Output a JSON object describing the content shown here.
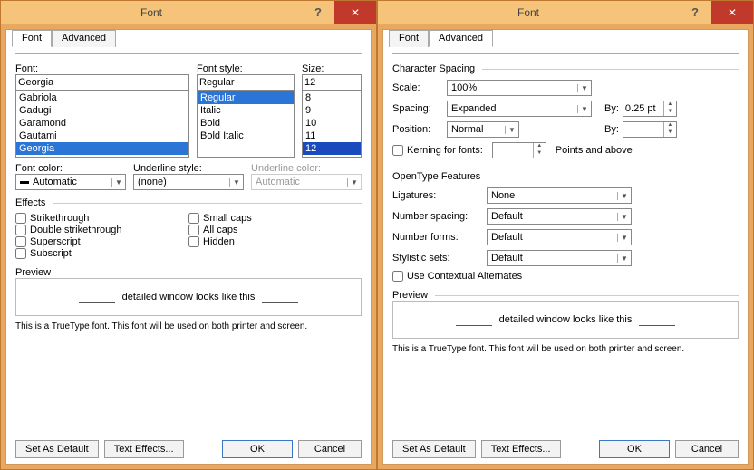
{
  "titlebar": {
    "title": "Font"
  },
  "tabs": {
    "font": "Font",
    "advanced": "Advanced"
  },
  "left": {
    "font_label": "Font:",
    "font_value": "Georgia",
    "font_list": [
      "Gabriola",
      "Gadugi",
      "Garamond",
      "Gautami",
      "Georgia"
    ],
    "style_label": "Font style:",
    "style_value": "Regular",
    "style_list": [
      "Regular",
      "Italic",
      "Bold",
      "Bold Italic"
    ],
    "size_label": "Size:",
    "size_value": "12",
    "size_list": [
      "8",
      "9",
      "10",
      "11",
      "12"
    ],
    "font_color_label": "Font color:",
    "font_color_value": "Automatic",
    "underline_style_label": "Underline style:",
    "underline_style_value": "(none)",
    "underline_color_label": "Underline color:",
    "underline_color_value": "Automatic",
    "effects_label": "Effects",
    "fx": {
      "strike": "Strikethrough",
      "dstrike": "Double strikethrough",
      "super": "Superscript",
      "sub": "Subscript",
      "smallcaps": "Small caps",
      "allcaps": "All caps",
      "hidden": "Hidden"
    }
  },
  "right": {
    "char_spacing": "Character Spacing",
    "scale_label": "Scale:",
    "scale_value": "100%",
    "spacing_label": "Spacing:",
    "spacing_value": "Expanded",
    "by1_label": "By:",
    "by1_value": "0.25 pt",
    "position_label": "Position:",
    "position_value": "Normal",
    "by2_label": "By:",
    "by2_value": "",
    "kerning_label": "Kerning for fonts:",
    "kerning_suffix": "Points and above",
    "ot_label": "OpenType Features",
    "ligatures_label": "Ligatures:",
    "ligatures_value": "None",
    "numspacing_label": "Number spacing:",
    "numspacing_value": "Default",
    "numforms_label": "Number forms:",
    "numforms_value": "Default",
    "stylistic_label": "Stylistic sets:",
    "stylistic_value": "Default",
    "context_alt": "Use Contextual Alternates"
  },
  "preview": {
    "label": "Preview",
    "text": "detailed window looks like this",
    "note": "This is a TrueType font. This font will be used on both printer and screen."
  },
  "buttons": {
    "set_default": "Set As Default",
    "text_effects": "Text Effects...",
    "ok": "OK",
    "cancel": "Cancel"
  }
}
